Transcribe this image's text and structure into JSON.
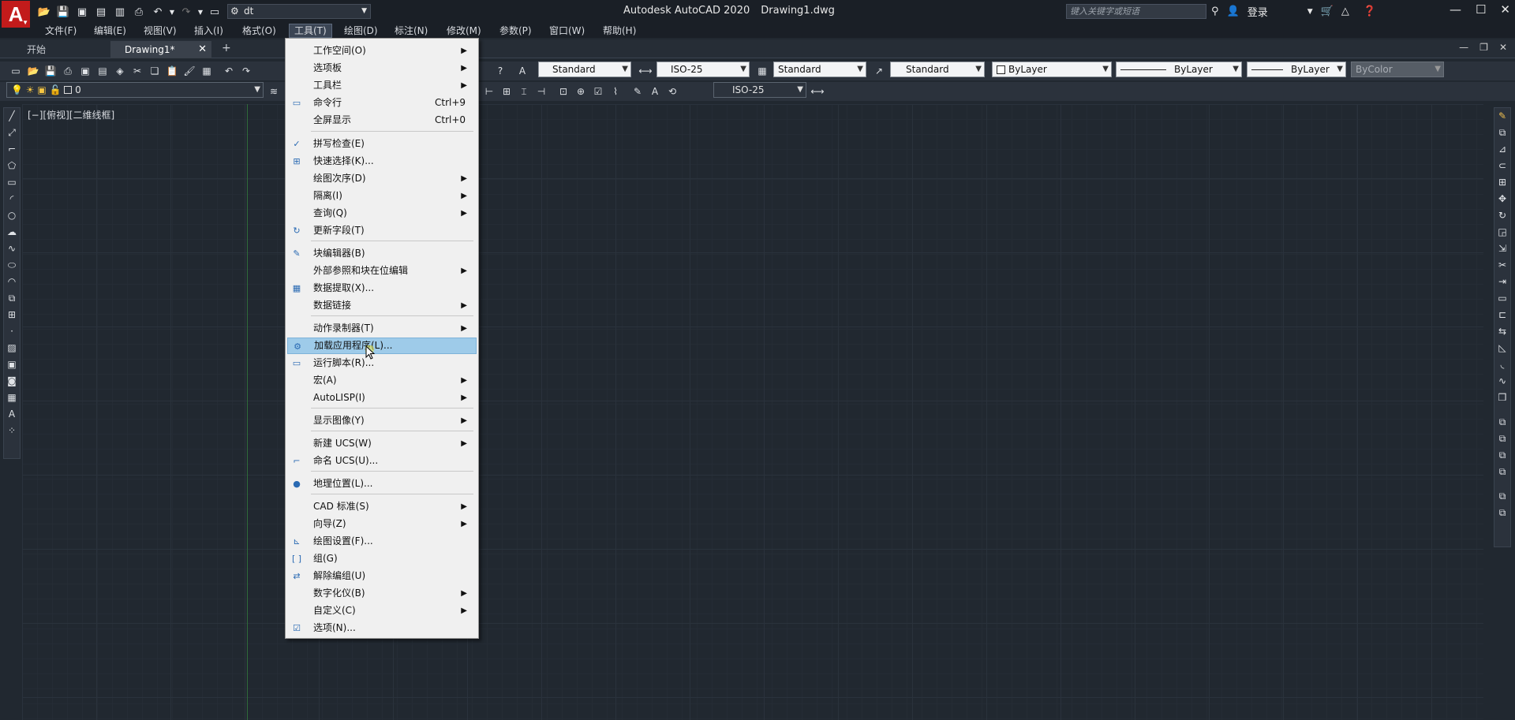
{
  "titlebar": {
    "app_logo": "A",
    "workspace": "dt",
    "app_name": "Autodesk AutoCAD 2020",
    "drawing_name": "Drawing1.dwg",
    "search_placeholder": "键入关键字或短语",
    "login": "登录"
  },
  "menubar": [
    "文件(F)",
    "编辑(E)",
    "视图(V)",
    "插入(I)",
    "格式(O)",
    "工具(T)",
    "绘图(D)",
    "标注(N)",
    "修改(M)",
    "参数(P)",
    "窗口(W)",
    "帮助(H)"
  ],
  "tabs": {
    "start": "开始",
    "drawing": "Drawing1*"
  },
  "toolbar": {
    "text_style": "Standard",
    "dim_style": "ISO-25",
    "table_style": "Standard",
    "mleader_style": "Standard",
    "color": "ByLayer",
    "linetype": "ByLayer",
    "lineweight": "ByLayer",
    "plotstyle": "ByColor",
    "layer": "0",
    "dim_style2": "ISO-25"
  },
  "viewport_label": "[−][俯视][二维线框]",
  "dropdown": {
    "items": [
      {
        "label": "工作空间(O)",
        "submenu": true
      },
      {
        "label": "选项板",
        "submenu": true
      },
      {
        "label": "工具栏",
        "submenu": true
      },
      {
        "label": "命令行",
        "shortcut": "Ctrl+9",
        "icon": "command-line-icon"
      },
      {
        "label": "全屏显示",
        "shortcut": "Ctrl+0"
      },
      {
        "label": "拼写检查(E)",
        "icon": "spell-check-icon"
      },
      {
        "label": "快速选择(K)...",
        "icon": "quick-select-icon"
      },
      {
        "label": "绘图次序(D)",
        "submenu": true
      },
      {
        "label": "隔离(I)",
        "submenu": true
      },
      {
        "label": "查询(Q)",
        "submenu": true
      },
      {
        "label": "更新字段(T)",
        "icon": "update-field-icon"
      },
      {
        "label": "块编辑器(B)",
        "icon": "block-editor-icon"
      },
      {
        "label": "外部参照和块在位编辑",
        "submenu": true
      },
      {
        "label": "数据提取(X)...",
        "icon": "data-extraction-icon"
      },
      {
        "label": "数据链接",
        "submenu": true
      },
      {
        "label": "动作录制器(T)",
        "submenu": true
      },
      {
        "label": "加载应用程序(L)...",
        "icon": "load-application-icon",
        "highlighted": true
      },
      {
        "label": "运行脚本(R)...",
        "icon": "run-script-icon"
      },
      {
        "label": "宏(A)",
        "submenu": true
      },
      {
        "label": "AutoLISP(I)",
        "submenu": true
      },
      {
        "label": "显示图像(Y)",
        "submenu": true
      },
      {
        "label": "新建 UCS(W)",
        "submenu": true
      },
      {
        "label": "命名 UCS(U)...",
        "icon": "named-ucs-icon"
      },
      {
        "label": "地理位置(L)...",
        "icon": "geolocation-icon"
      },
      {
        "label": "CAD 标准(S)",
        "submenu": true
      },
      {
        "label": "向导(Z)",
        "submenu": true
      },
      {
        "label": "绘图设置(F)...",
        "icon": "drafting-settings-icon"
      },
      {
        "label": "组(G)",
        "icon": "group-icon"
      },
      {
        "label": "解除编组(U)",
        "icon": "ungroup-icon"
      },
      {
        "label": "数字化仪(B)",
        "submenu": true
      },
      {
        "label": "自定义(C)",
        "submenu": true
      },
      {
        "label": "选项(N)...",
        "icon": "options-check-icon"
      }
    ]
  },
  "colors": {
    "accent_red": "#c21b1b",
    "menu_highlight": "#9ecbe9",
    "canvas": "#212830"
  }
}
